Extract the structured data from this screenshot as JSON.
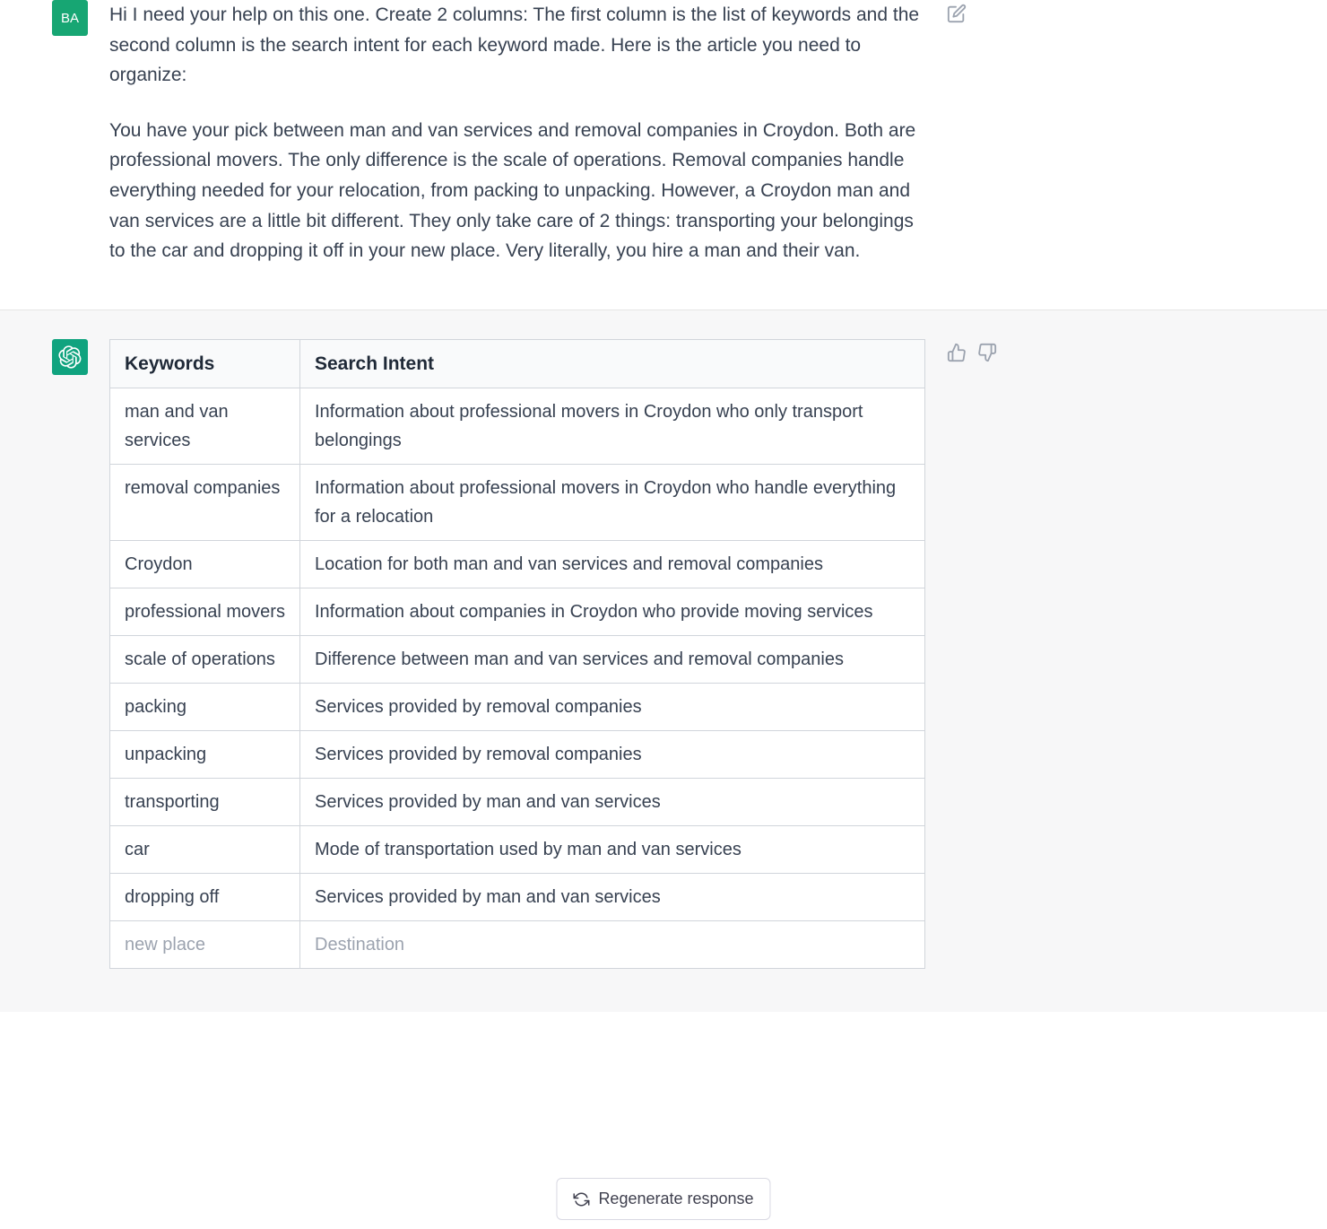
{
  "user": {
    "avatar_initials": "BA",
    "paragraph1": "Hi I need your help on this one. Create 2 columns: The first column is the list of keywords and the second column is the search intent for each keyword made. Here is the article you need to organize:",
    "paragraph2": "You have your pick between man and van services and removal companies in Croydon. Both are professional movers. The only difference is the scale of operations. Removal companies handle everything needed for your relocation, from packing to unpacking. However, a Croydon man and van services are a little bit different. They only take care of 2 things: transporting your belongings to the car and dropping it off in your new place. Very literally, you hire a man and their van."
  },
  "table": {
    "headers": [
      "Keywords",
      "Search Intent"
    ],
    "rows": [
      {
        "keyword": "man and van services",
        "intent": "Information about professional movers in Croydon who only transport belongings"
      },
      {
        "keyword": "removal companies",
        "intent": "Information about professional movers in Croydon who handle everything for a relocation"
      },
      {
        "keyword": "Croydon",
        "intent": "Location for both man and van services and removal companies"
      },
      {
        "keyword": "professional movers",
        "intent": "Information about companies in Croydon who provide moving services"
      },
      {
        "keyword": "scale of operations",
        "intent": "Difference between man and van services and removal companies"
      },
      {
        "keyword": "packing",
        "intent": "Services provided by removal companies"
      },
      {
        "keyword": "unpacking",
        "intent": "Services provided by removal companies"
      },
      {
        "keyword": "transporting",
        "intent": "Services provided by man and van services"
      },
      {
        "keyword": "car",
        "intent": "Mode of transportation used by man and van services"
      },
      {
        "keyword": "dropping off",
        "intent": "Services provided by man and van services"
      },
      {
        "keyword": "new place",
        "intent": "Destination "
      }
    ]
  },
  "regenerate_label": "Regenerate response"
}
